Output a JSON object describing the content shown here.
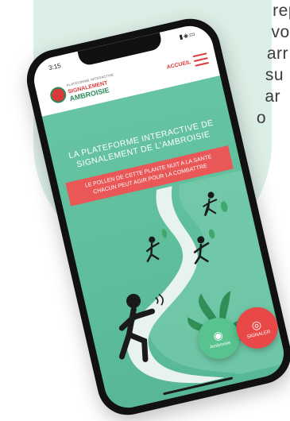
{
  "background": {
    "text_lines": [
      "rep",
      "vot",
      "arr",
      "su",
      "ar",
      "o"
    ]
  },
  "status_bar": {
    "time": "3:15",
    "icons": [
      "signal-icon",
      "wifi-icon",
      "battery-icon"
    ]
  },
  "header": {
    "logo": {
      "small_text": "PLATEFORME INTERACTIVE",
      "line1": "SIGNALEMENT",
      "line2": "AMBROISIE"
    },
    "nav_label": "ACCUEIL",
    "menu_icon": "hamburger-icon"
  },
  "hero": {
    "title_line1": "LA PLATEFORME INTERACTIVE DE",
    "title_line2": "SIGNALEMENT DE L'AMBROISIE",
    "banner_line1": "LE POLLEN DE CETTE PLANTE NUIT A LA SANTE",
    "banner_line2": "CHACUN PEUT AGIR POUR LA COMBATTRE"
  },
  "actions": {
    "ambrosia_label": "Ambroisie",
    "signaler_label": "SIGNALER"
  },
  "colors": {
    "accent_red": "#e95757",
    "brand_green": "#58b896",
    "button_green": "#58c38e",
    "button_red": "#e94848"
  }
}
